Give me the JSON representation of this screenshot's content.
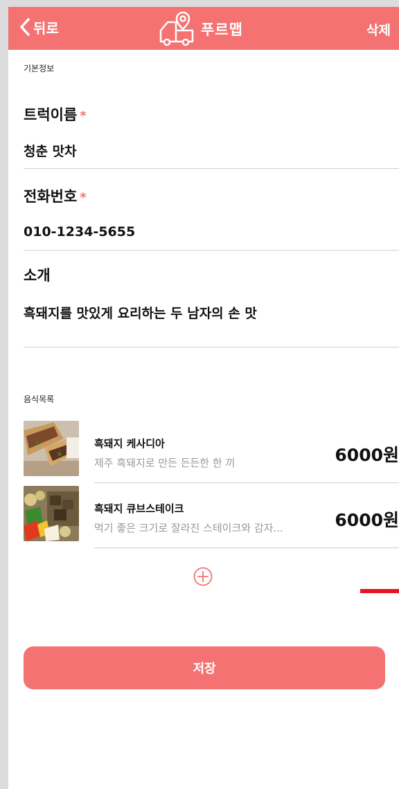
{
  "header": {
    "back_label": "뒤로",
    "app_title": "푸르맵",
    "delete_label": "삭제"
  },
  "basic_info": {
    "section_label": "기본정보",
    "truck_name": {
      "label": "트럭이름",
      "required_mark": "*",
      "value": "청춘 맛차"
    },
    "phone": {
      "label": "전화번호",
      "required_mark": "*",
      "value": "010-1234-5655"
    },
    "intro": {
      "label": "소개",
      "value": "흑돼지를 맛있게 요리하는 두 남자의 손 맛"
    }
  },
  "food_list": {
    "section_label": "음식목록",
    "items": [
      {
        "name": "흑돼지 케사디아",
        "description": "제주 흑돼지로 만든 든든한 한 끼",
        "price": "6000원"
      },
      {
        "name": "흑돼지 큐브스테이크",
        "description": "먹기 좋은 크기로 잘라진 스테이크와 감자...",
        "price": "6000원"
      }
    ]
  },
  "save_label": "저장",
  "colors": {
    "brand": "#f47272",
    "required": "#f47272",
    "accent_mark": "#e8141e",
    "muted_text": "#999999"
  },
  "icons": {
    "back": "chevron-left-icon",
    "logo": "food-truck-map-pin-icon",
    "add": "plus-circle-icon"
  }
}
